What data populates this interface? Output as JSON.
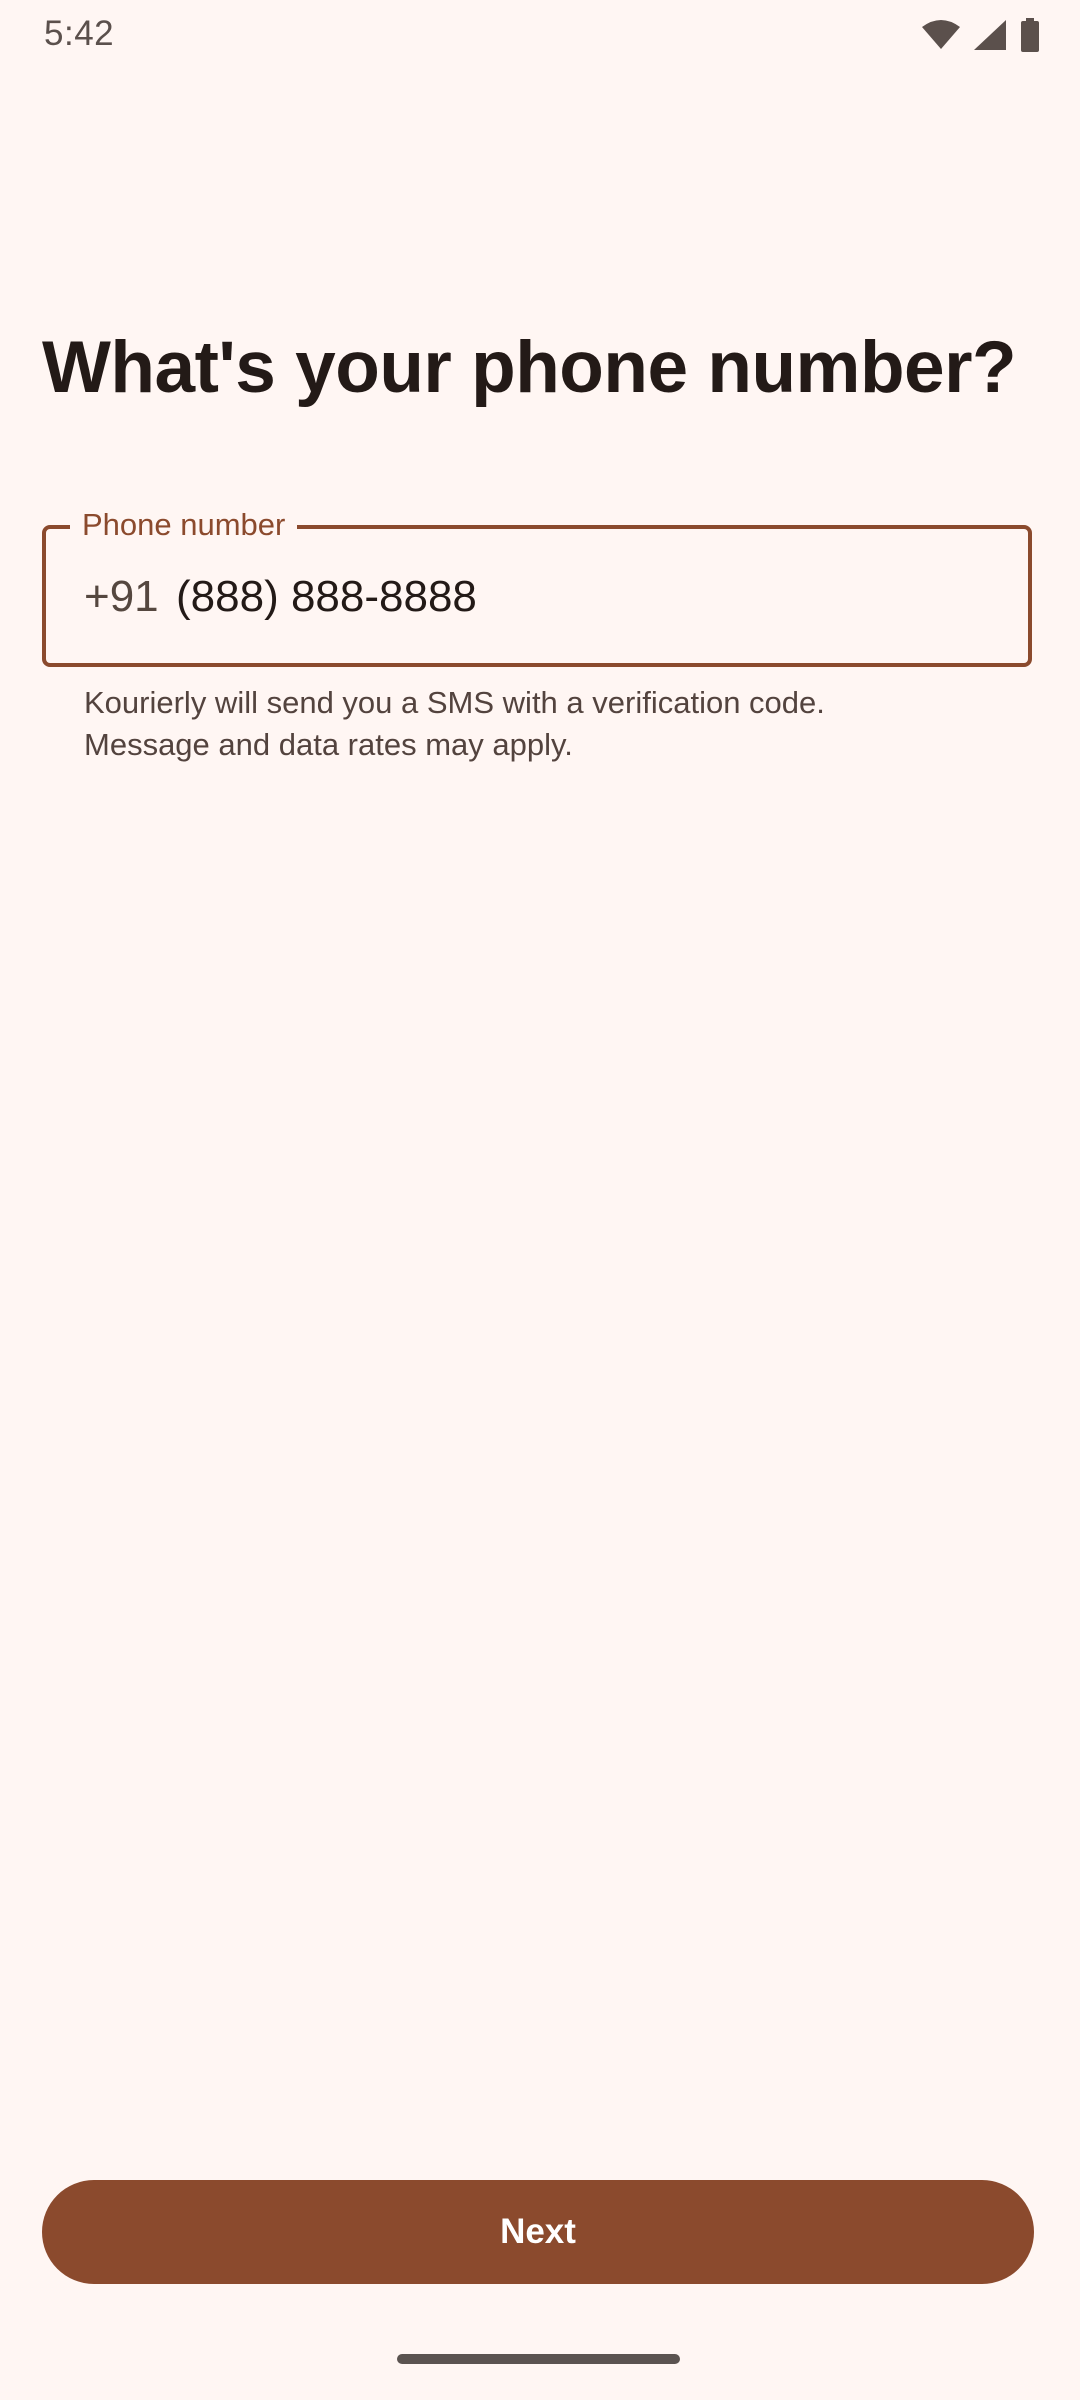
{
  "status_bar": {
    "time": "5:42",
    "icons": [
      "wifi-icon",
      "cellular-signal-icon",
      "battery-icon"
    ]
  },
  "title": "What's your phone number?",
  "phone_field": {
    "label": "Phone number",
    "prefix": "+91",
    "value": "(888) 888-8888"
  },
  "helper": {
    "line1": "Kourierly will send you a SMS with a verification code.",
    "line2": "Message and data rates may apply."
  },
  "next_button": {
    "label": "Next"
  },
  "colors": {
    "background": "#FFF6F3",
    "accent": "#8B4A2D",
    "text": "#231A17"
  }
}
